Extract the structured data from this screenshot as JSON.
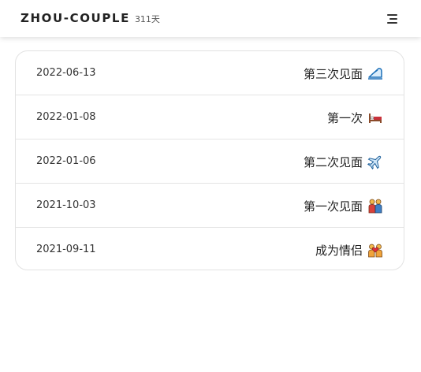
{
  "header": {
    "title": "ZHOU-COUPLE",
    "days": "311天",
    "menu_icon": "menu-icon"
  },
  "events": [
    {
      "date": "2022-06-13",
      "title": "第三次见面",
      "icon": "train-icon"
    },
    {
      "date": "2022-01-08",
      "title": "第一次",
      "icon": "bed-icon"
    },
    {
      "date": "2022-01-06",
      "title": "第二次见面",
      "icon": "airplane-icon"
    },
    {
      "date": "2021-10-03",
      "title": "第一次见面",
      "icon": "couple-icon"
    },
    {
      "date": "2021-09-11",
      "title": "成为情侣",
      "icon": "couple-heart-icon"
    }
  ]
}
